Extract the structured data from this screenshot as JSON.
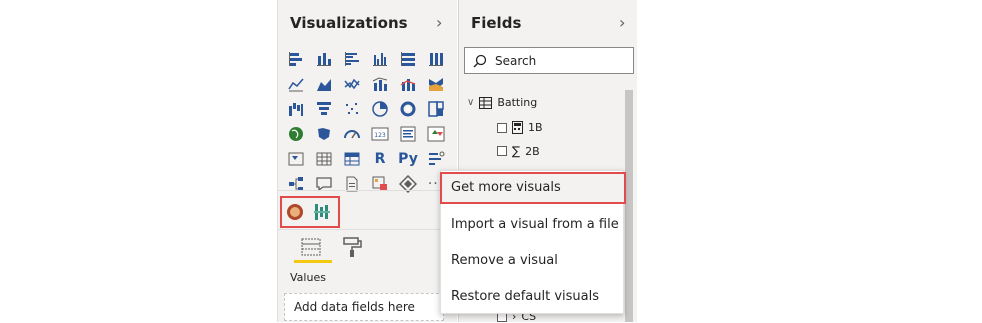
{
  "viz_pane": {
    "title": "Visualizations",
    "values_label": "Values",
    "add_fields": "Add data fields here"
  },
  "fields_pane": {
    "title": "Fields",
    "search_placeholder": "Search",
    "table": "Batting",
    "items": [
      "1B",
      "2B",
      "CS"
    ]
  },
  "context_menu": {
    "items": [
      "Get more visuals",
      "Import a visual from a file",
      "Remove a visual",
      "Restore default visuals"
    ]
  },
  "viz_icons": [
    "stacked-bar-chart-icon",
    "stacked-column-chart-icon",
    "clustered-bar-chart-icon",
    "clustered-column-chart-icon",
    "100-stacked-bar-chart-icon",
    "100-stacked-column-chart-icon",
    "line-chart-icon",
    "area-chart-icon",
    "stacked-area-chart-icon",
    "line-clustered-column-icon",
    "line-stacked-column-icon",
    "ribbon-chart-icon",
    "waterfall-chart-icon",
    "funnel-icon",
    "scatter-chart-icon",
    "pie-chart-icon",
    "donut-chart-icon",
    "treemap-icon",
    "map-icon",
    "filled-map-icon",
    "gauge-icon",
    "card-icon",
    "multi-row-card-icon",
    "kpi-icon",
    "slicer-icon",
    "table-icon",
    "matrix-icon",
    "r-visual-icon",
    "python-visual-icon",
    "key-influencers-icon",
    "decomposition-tree-icon",
    "qa-icon",
    "smart-narrative-icon",
    "paginated-report-icon",
    "power-apps-icon",
    "more-options-icon"
  ],
  "text_icons": {
    "r": "R",
    "py": "Py",
    "card": "123",
    "more": "···"
  },
  "colors": {
    "accent": "#f2c811",
    "highlight_border": "#e04b4b",
    "icon_blue": "#2b579a"
  }
}
